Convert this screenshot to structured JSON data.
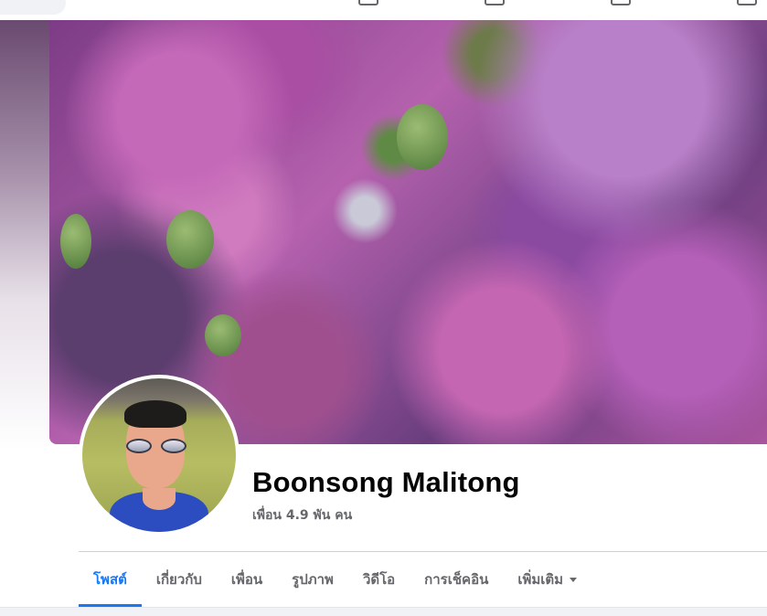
{
  "profile": {
    "name": "Boonsong Malitong",
    "friends_count": "เพื่อน 4.9 พัน คน"
  },
  "tabs": [
    {
      "label": "โพสต์",
      "active": true
    },
    {
      "label": "เกี่ยวกับ",
      "active": false
    },
    {
      "label": "เพื่อน",
      "active": false
    },
    {
      "label": "รูปภาพ",
      "active": false
    },
    {
      "label": "วิดีโอ",
      "active": false
    },
    {
      "label": "การเช็คอิน",
      "active": false
    },
    {
      "label": "เพิ่มเติม",
      "active": false,
      "icon": "caret-down-icon"
    }
  ],
  "colors": {
    "accent": "#1877f2",
    "text_primary": "#050505",
    "text_secondary": "#65676b"
  }
}
